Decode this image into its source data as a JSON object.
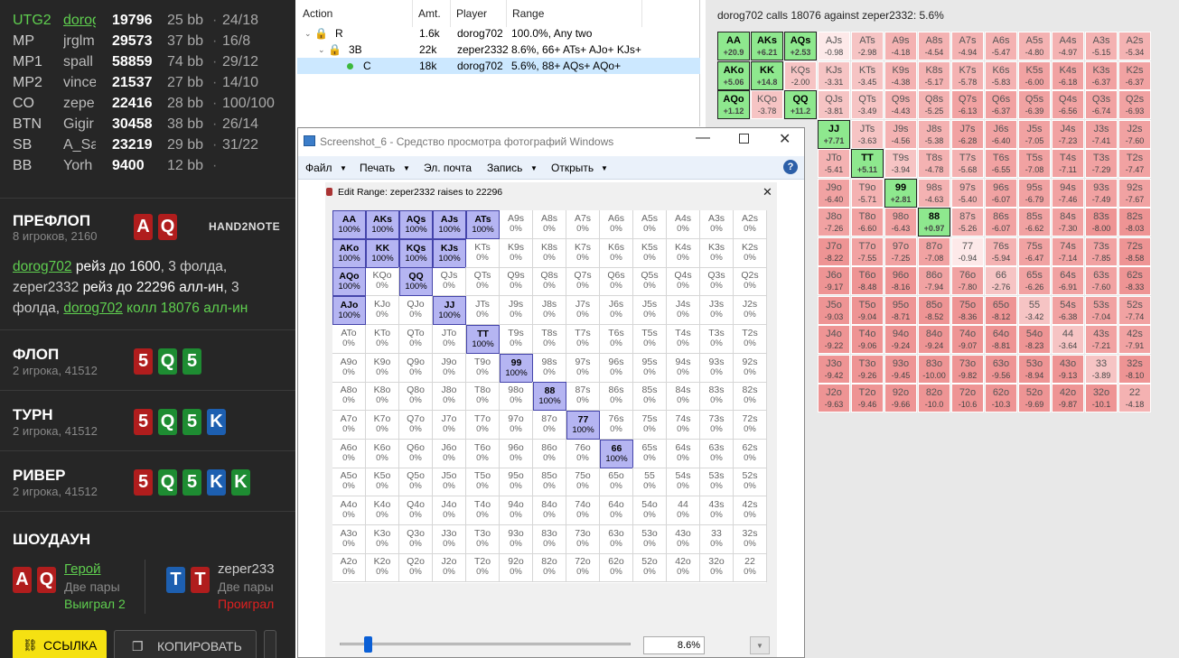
{
  "seats": [
    {
      "pos": "UTG2",
      "name": "dorog",
      "stack": "19796",
      "bb": "25 bb",
      "act": "24/18",
      "hero": true
    },
    {
      "pos": "MP",
      "name": "jrglm",
      "stack": "29573",
      "bb": "37 bb",
      "act": "16/8"
    },
    {
      "pos": "MP1",
      "name": "spall",
      "stack": "58859",
      "bb": "74 bb",
      "act": "29/12"
    },
    {
      "pos": "MP2",
      "name": "vince",
      "stack": "21537",
      "bb": "27 bb",
      "act": "14/10"
    },
    {
      "pos": "CO",
      "name": "zepe",
      "stack": "22416",
      "bb": "28 bb",
      "act": "100/100"
    },
    {
      "pos": "BTN",
      "name": "Gigir",
      "stack": "30458",
      "bb": "38 bb",
      "act": "26/14"
    },
    {
      "pos": "SB",
      "name": "A_Sa",
      "stack": "23219",
      "bb": "29 bb",
      "act": "31/22"
    },
    {
      "pos": "BB",
      "name": "Yorh",
      "stack": "9400",
      "bb": "12 bb",
      "act": ""
    }
  ],
  "sep": "·",
  "preflop": {
    "title": "ПРЕФЛОП",
    "sub": "8 игроков, 2160",
    "cards": [
      "A",
      "Q"
    ],
    "logo": "HAND2NOTE",
    "a1": "dorog702",
    "a2": " рейз до 1600",
    "a3": ", 3 фолда, zeper2332 ",
    "a4": "рейз до 22296 алл-ин",
    "a5": ", 3 фолда, ",
    "a6": "dorog702",
    "a7": " колл 18076 алл-ин"
  },
  "flop": {
    "title": "ФЛОП",
    "sub": "2 игрока, 41512",
    "cards": [
      "5",
      "Q",
      "5"
    ]
  },
  "turn": {
    "title": "ТУРН",
    "sub": "2 игрока, 41512",
    "cards": [
      "5",
      "Q",
      "5",
      "K"
    ]
  },
  "river": {
    "title": "РИВЕР",
    "sub": "2 игрока, 41512",
    "cards": [
      "5",
      "Q",
      "5",
      "K",
      "K"
    ]
  },
  "showdown": {
    "title": "ШОУДАУН",
    "p1": {
      "cards": [
        "A",
        "Q"
      ],
      "name": "Герой",
      "hand": "Две пары",
      "result": "Выиграл 2"
    },
    "p2": {
      "cards": [
        "T",
        "T"
      ],
      "name": "zeper233",
      "hand": "Две пары",
      "result": "Проиграл"
    }
  },
  "buttons": {
    "link": "ССЫЛКА",
    "copy": "КОПИРОВАТЬ"
  },
  "action_table": {
    "headers": [
      "Action",
      "Amt.",
      "Player",
      "Range"
    ],
    "rows": [
      {
        "action": "R",
        "amt": "1.6k",
        "player": "dorog702",
        "range": "100.0%, Any two"
      },
      {
        "action": "3B",
        "amt": "22k",
        "player": "zeper2332",
        "range": "8.6%, 66+ ATs+ AJo+ KJs+"
      },
      {
        "action": "C",
        "amt": "18k",
        "player": "dorog702",
        "range": "5.6%, 88+ AQs+ AQo+"
      }
    ]
  },
  "ev_title": "dorog702 calls 18076 against zeper2332: 5.6%",
  "ev_cells": [
    [
      "AA",
      "+20.9"
    ],
    [
      "AKs",
      "+6.21"
    ],
    [
      "AQs",
      "+2.53"
    ],
    [
      "AJs",
      "-0.98"
    ],
    [
      "ATs",
      "-2.98"
    ],
    [
      "A9s",
      "-4.18"
    ],
    [
      "A8s",
      "-4.54"
    ],
    [
      "A7s",
      "-4.94"
    ],
    [
      "A6s",
      "-5.47"
    ],
    [
      "A5s",
      "-4.80"
    ],
    [
      "A4s",
      "-4.97"
    ],
    [
      "A3s",
      "-5.15"
    ],
    [
      "A2s",
      "-5.34"
    ],
    [
      "AKo",
      "+5.06"
    ],
    [
      "KK",
      "+14.8"
    ],
    [
      "KQs",
      "-2.00"
    ],
    [
      "KJs",
      "-3.31"
    ],
    [
      "KTs",
      "-3.45"
    ],
    [
      "K9s",
      "-4.38"
    ],
    [
      "K8s",
      "-5.17"
    ],
    [
      "K7s",
      "-5.78"
    ],
    [
      "K6s",
      "-5.83"
    ],
    [
      "K5s",
      "-6.00"
    ],
    [
      "K4s",
      "-6.18"
    ],
    [
      "K3s",
      "-6.37"
    ],
    [
      "K2s",
      "-6.37"
    ],
    [
      "AQo",
      "+1.12"
    ],
    [
      "KQo",
      "-3.78"
    ],
    [
      "QQ",
      "+11.2"
    ],
    [
      "QJs",
      "-3.81"
    ],
    [
      "QTs",
      "-3.49"
    ],
    [
      "Q9s",
      "-4.43"
    ],
    [
      "Q8s",
      "-5.25"
    ],
    [
      "Q7s",
      "-6.13"
    ],
    [
      "Q6s",
      "-6.37"
    ],
    [
      "Q5s",
      "-6.39"
    ],
    [
      "Q4s",
      "-6.56"
    ],
    [
      "Q3s",
      "-6.74"
    ],
    [
      "Q2s",
      "-6.93"
    ],
    [
      "",
      "",
      1
    ],
    [
      "",
      "",
      1
    ],
    [
      "",
      "",
      1
    ],
    [
      "JJ",
      "+7.71"
    ],
    [
      "JTs",
      "-3.63"
    ],
    [
      "J9s",
      "-4.56"
    ],
    [
      "J8s",
      "-5.38"
    ],
    [
      "J7s",
      "-6.28"
    ],
    [
      "J6s",
      "-6.40"
    ],
    [
      "J5s",
      "-7.05"
    ],
    [
      "J4s",
      "-7.23"
    ],
    [
      "J3s",
      "-7.41"
    ],
    [
      "J2s",
      "-7.60"
    ],
    [
      "",
      "",
      1
    ],
    [
      "",
      "",
      1
    ],
    [
      "",
      "",
      1
    ],
    [
      "JTo",
      "-5.41"
    ],
    [
      "TT",
      "+5.11"
    ],
    [
      "T9s",
      "-3.94"
    ],
    [
      "T8s",
      "-4.78"
    ],
    [
      "T7s",
      "-5.68"
    ],
    [
      "T6s",
      "-6.55"
    ],
    [
      "T5s",
      "-7.08"
    ],
    [
      "T4s",
      "-7.11"
    ],
    [
      "T3s",
      "-7.29"
    ],
    [
      "T2s",
      "-7.47"
    ],
    [
      "",
      "",
      1
    ],
    [
      "",
      "",
      1
    ],
    [
      "",
      "",
      1
    ],
    [
      "J9o",
      "-6.40"
    ],
    [
      "T9o",
      "-5.71"
    ],
    [
      "99",
      "+2.81"
    ],
    [
      "98s",
      "-4.63"
    ],
    [
      "97s",
      "-5.40"
    ],
    [
      "96s",
      "-6.07"
    ],
    [
      "95s",
      "-6.79"
    ],
    [
      "94s",
      "-7.46"
    ],
    [
      "93s",
      "-7.49"
    ],
    [
      "92s",
      "-7.67"
    ],
    [
      "",
      "",
      1
    ],
    [
      "",
      "",
      1
    ],
    [
      "",
      "",
      1
    ],
    [
      "J8o",
      "-7.26"
    ],
    [
      "T8o",
      "-6.60"
    ],
    [
      "98o",
      "-6.43"
    ],
    [
      "88",
      "+0.97"
    ],
    [
      "87s",
      "-5.26"
    ],
    [
      "86s",
      "-6.07"
    ],
    [
      "85s",
      "-6.62"
    ],
    [
      "84s",
      "-7.30"
    ],
    [
      "83s",
      "-8.00"
    ],
    [
      "82s",
      "-8.03"
    ],
    [
      "",
      "",
      1
    ],
    [
      "",
      "",
      1
    ],
    [
      "",
      "",
      1
    ],
    [
      "J7o",
      "-8.22"
    ],
    [
      "T7o",
      "-7.55"
    ],
    [
      "97o",
      "-7.25"
    ],
    [
      "87o",
      "-7.08"
    ],
    [
      "77",
      "-0.94"
    ],
    [
      "76s",
      "-5.94"
    ],
    [
      "75s",
      "-6.47"
    ],
    [
      "74s",
      "-7.14"
    ],
    [
      "73s",
      "-7.85"
    ],
    [
      "72s",
      "-8.58"
    ],
    [
      "",
      "",
      1
    ],
    [
      "",
      "",
      1
    ],
    [
      "",
      "",
      1
    ],
    [
      "J6o",
      "-9.17"
    ],
    [
      "T6o",
      "-8.48"
    ],
    [
      "96o",
      "-8.16"
    ],
    [
      "86o",
      "-7.94"
    ],
    [
      "76o",
      "-7.80"
    ],
    [
      "66",
      "-2.76"
    ],
    [
      "65s",
      "-6.26"
    ],
    [
      "64s",
      "-6.91"
    ],
    [
      "63s",
      "-7.60"
    ],
    [
      "62s",
      "-8.33"
    ],
    [
      "",
      "",
      1
    ],
    [
      "",
      "",
      1
    ],
    [
      "",
      "",
      1
    ],
    [
      "J5o",
      "-9.03"
    ],
    [
      "T5o",
      "-9.04"
    ],
    [
      "95o",
      "-8.71"
    ],
    [
      "85o",
      "-8.52"
    ],
    [
      "75o",
      "-8.36"
    ],
    [
      "65o",
      "-8.12"
    ],
    [
      "55",
      "-3.42"
    ],
    [
      "54s",
      "-6.38"
    ],
    [
      "53s",
      "-7.04"
    ],
    [
      "52s",
      "-7.74"
    ],
    [
      "",
      "",
      1
    ],
    [
      "",
      "",
      1
    ],
    [
      "",
      "",
      1
    ],
    [
      "J4o",
      "-9.22"
    ],
    [
      "T4o",
      "-9.06"
    ],
    [
      "94o",
      "-9.24"
    ],
    [
      "84o",
      "-9.24"
    ],
    [
      "74o",
      "-9.07"
    ],
    [
      "64o",
      "-8.81"
    ],
    [
      "54o",
      "-8.23"
    ],
    [
      "44",
      "-3.64"
    ],
    [
      "43s",
      "-7.21"
    ],
    [
      "42s",
      "-7.91"
    ],
    [
      "",
      "",
      1
    ],
    [
      "",
      "",
      1
    ],
    [
      "",
      "",
      1
    ],
    [
      "J3o",
      "-9.42"
    ],
    [
      "T3o",
      "-9.26"
    ],
    [
      "93o",
      "-9.45"
    ],
    [
      "83o",
      "-10.00"
    ],
    [
      "73o",
      "-9.82"
    ],
    [
      "63o",
      "-9.56"
    ],
    [
      "53o",
      "-8.94"
    ],
    [
      "43o",
      "-9.13"
    ],
    [
      "33",
      "-3.89"
    ],
    [
      "32s",
      "-8.10"
    ],
    [
      "",
      "",
      1
    ],
    [
      "",
      "",
      1
    ],
    [
      "",
      "",
      1
    ],
    [
      "J2o",
      "-9.63"
    ],
    [
      "T2o",
      "-9.46"
    ],
    [
      "92o",
      "-9.66"
    ],
    [
      "82o",
      "-10.0"
    ],
    [
      "72o",
      "-10.6"
    ],
    [
      "62o",
      "-10.3"
    ],
    [
      "52o",
      "-9.69"
    ],
    [
      "42o",
      "-9.87"
    ],
    [
      "32o",
      "-10.1"
    ],
    [
      "22",
      "-4.18"
    ]
  ],
  "photo_window": {
    "title": "Screenshot_6 - Средство просмотра фотографий Windows",
    "menu": [
      "Файл",
      "Печать",
      "Эл. почта",
      "Запись",
      "Открыть"
    ],
    "help": "?"
  },
  "edit_range": {
    "title": "Edit Range: zeper2332 raises to 22296",
    "percent": "8.6%",
    "selected": [
      "AA",
      "AKs",
      "AQs",
      "AJs",
      "ATs",
      "AKo",
      "KK",
      "KQs",
      "KJs",
      "AQo",
      "QQ",
      "AJo",
      "JJ",
      "TT",
      "99",
      "88",
      "77",
      "66"
    ],
    "sel_value": "100%",
    "unsel_value": "0%"
  }
}
